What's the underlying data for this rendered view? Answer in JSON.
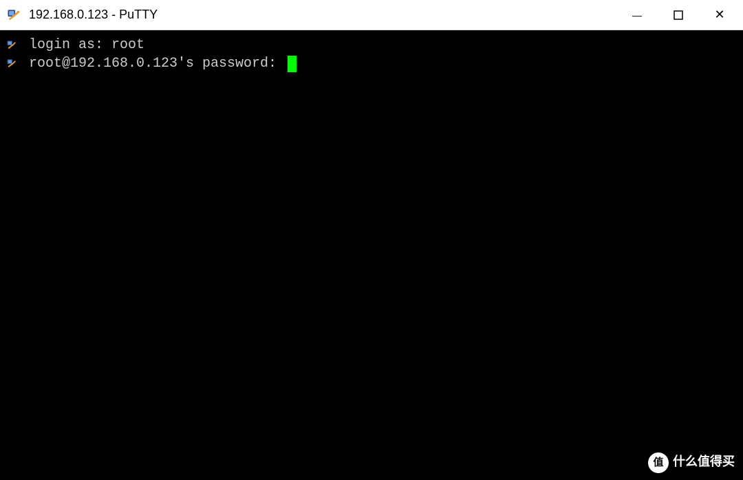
{
  "window": {
    "title": "192.168.0.123 - PuTTY"
  },
  "controls": {
    "minimize": "—",
    "maximize": "☐",
    "close": "✕"
  },
  "terminal": {
    "lines": [
      "login as: root",
      "root@192.168.0.123's password: "
    ]
  },
  "watermark": {
    "badge": "值",
    "text": "什么值得买"
  }
}
